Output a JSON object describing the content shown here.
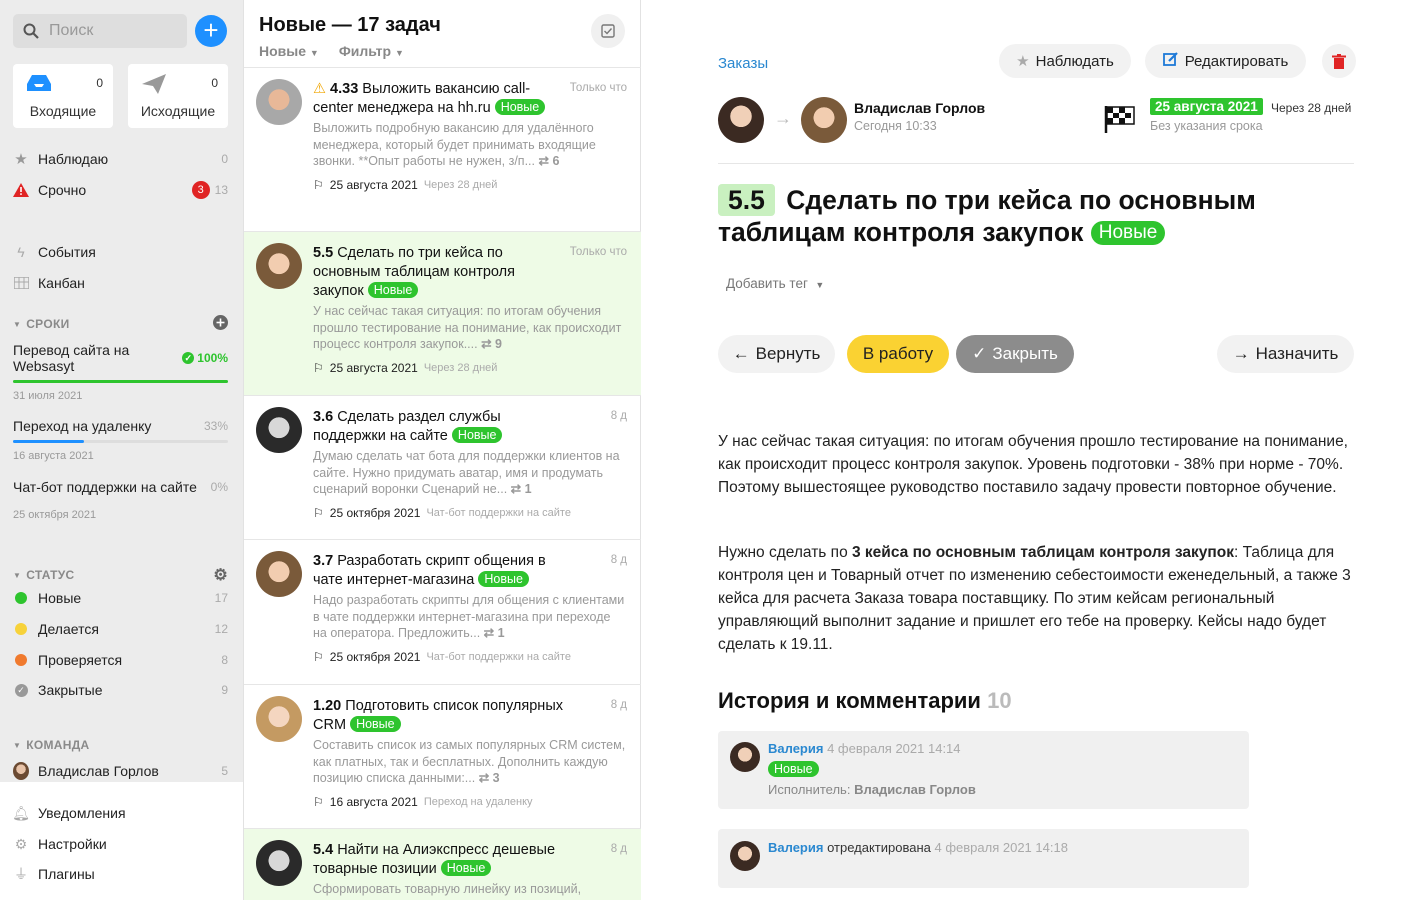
{
  "sidebar": {
    "search_placeholder": "Поиск",
    "add_label": "+",
    "inbox": {
      "label": "Входящие",
      "count": "0"
    },
    "outbox": {
      "label": "Исходящие",
      "count": "0"
    },
    "watch": {
      "label": "Наблюдаю",
      "count": "0"
    },
    "urgent": {
      "label": "Срочно",
      "badge": "3",
      "count": "13"
    },
    "events": "События",
    "kanban": "Канбан",
    "deadlines": {
      "title": "СРОКИ"
    },
    "projects": [
      {
        "name": "Перевод сайта на Websasyt",
        "pct": "100%",
        "progress": 1.0,
        "date": "31 июля 2021"
      },
      {
        "name": "Переход на удаленку",
        "pct": "33%",
        "progress": 0.33,
        "date": "16 августа 2021"
      },
      {
        "name": "Чат-бот поддержки на сайте",
        "pct": "0%",
        "progress": 0,
        "date": "25 октября 2021"
      }
    ],
    "status": {
      "title": "СТАТУС",
      "items": [
        {
          "label": "Новые",
          "count": "17",
          "color": "#2ec42e"
        },
        {
          "label": "Делается",
          "count": "12",
          "color": "#f7d23a"
        },
        {
          "label": "Проверяется",
          "count": "8",
          "color": "#f07a2e"
        },
        {
          "label": "Закрытые",
          "count": "9",
          "color": "#999999"
        }
      ]
    },
    "team": {
      "title": "КОМАНДА",
      "member": "Владислав Горлов",
      "count": "5"
    },
    "notifications": "Уведомления",
    "settings": "Настройки",
    "plugins": "Плагины"
  },
  "list": {
    "title": "Новые — 17 задач",
    "filter_status": "Новые",
    "filter": "Фильтр",
    "tasks": [
      {
        "num": "4.33",
        "title": "Выложить вакансию call-center менеджера на hh.ru",
        "badge": "Новые",
        "when": "Только что",
        "desc": "Выложить подробную вакансию для удалённого менеджера, который будет принимать входящие звонки. **Опыт работы не нужен, з/п...",
        "sub": "6",
        "date": "25 августа 2021",
        "project": "Через 28 дней"
      },
      {
        "num": "5.5",
        "title": "Сделать по три кейса по основным таблицам контроля закупок",
        "badge": "Новые",
        "when": "Только что",
        "desc": "У нас сейчас такая ситуация: по итогам обучения прошло тестирование на понимание, как происходит процесс контроля закупок....",
        "sub": "9",
        "date": "25 августа 2021",
        "project": "Через 28 дней"
      },
      {
        "num": "3.6",
        "title": "Сделать раздел службы поддержки на сайте",
        "badge": "Новые",
        "when": "8 д",
        "desc": "Думаю сделать чат бота для поддержки клиентов на сайте. Нужно придумать аватар, имя и продумать сценарий воронки Сценарий не...",
        "sub": "1",
        "date": "25 октября 2021",
        "project": "Чат-бот поддержки на сайте"
      },
      {
        "num": "3.7",
        "title": "Разработать скрипт общения в чате интернет-магазина",
        "badge": "Новые",
        "when": "8 д",
        "desc": "Надо разработать скрипты для общения с клиентами в чате поддержки интернет-магазина при переходе на оператора. Предложить...",
        "sub": "1",
        "date": "25 октября 2021",
        "project": "Чат-бот поддержки на сайте"
      },
      {
        "num": "1.20",
        "title": "Подготовить список популярных CRM",
        "badge": "Новые",
        "when": "8 д",
        "desc": "Составить список из самых популярных CRM систем, как платных, так и бесплатных. Дополнить каждую позицию списка данными:...",
        "sub": "3",
        "date": "16 августа 2021",
        "project": "Переход на удаленку"
      },
      {
        "num": "5.4",
        "title": "Найти на Алиэкспресс дешевые товарные позиции",
        "badge": "Новые",
        "when": "8 д",
        "desc": "Сформировать товарную линейку из позиций,",
        "sub": "",
        "date": "",
        "project": ""
      }
    ]
  },
  "detail": {
    "breadcrumb": "Заказы",
    "watch_button": "Наблюдать",
    "edit_button": "Редактировать",
    "assignee": "Владислав Горлов",
    "assigned_time": "Сегодня 10:33",
    "due_date": "25 августа 2021",
    "due_in": "Через 28 дней",
    "no_deadline": "Без указания срока",
    "num": "5.5",
    "title": "Сделать по три кейса по основным таблицам контроля закупок",
    "badge": "Новые",
    "add_tag": "Добавить тег",
    "btn_return": "Вернуть",
    "btn_work": "В работу",
    "btn_close": "Закрыть",
    "btn_assign": "Назначить",
    "para1": "У нас сейчас такая ситуация: по итогам обучения прошло тестирование на понимание, как происходит процесс контроля закупок. Уровень подготовки - 38% при норме - 70%. Поэтому вышестоящее руководство поставило задачу провести повторное обучение.",
    "para2_pre": "Нужно сделать по ",
    "para2_bold": "3 кейса по основным таблицам контроля закупок",
    "para2_post": ": Таблица для контроля цен и Товарный отчет по изменению себестоимости еженедельный, а также 3 кейса для расчета Заказа товара поставщику. По этим кейсам региональный управляющий выполнит задание и пришлет его тебе на проверку. Кейсы надо будет сделать к 19.11.",
    "history_title": "История и комментарии",
    "history_count": "10",
    "comments": [
      {
        "author": "Валерия",
        "time": "4 февраля 2021 14:14",
        "badge": "Новые",
        "line_label": "Исполнитель:",
        "line_value": "Владислав Горлов"
      },
      {
        "author": "Валерия",
        "action": "отредактирована",
        "time": "4 февраля 2021 14:18"
      }
    ]
  }
}
